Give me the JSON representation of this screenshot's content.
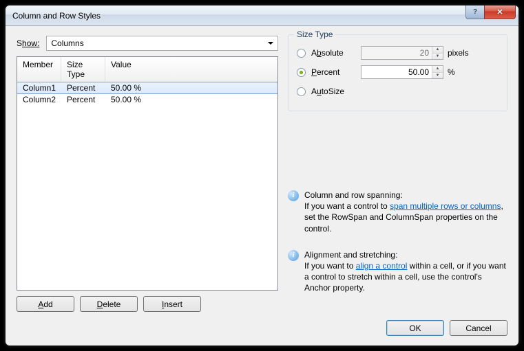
{
  "title": "Column and Row Styles",
  "show_label_pre": "S",
  "show_label_post": "how:",
  "show_value": "Columns",
  "headers": {
    "member": "Member",
    "size_type": "Size Type",
    "value": "Value"
  },
  "rows": [
    {
      "member": "Column1",
      "type": "Percent",
      "value": "50.00 %",
      "selected": true
    },
    {
      "member": "Column2",
      "type": "Percent",
      "value": "50.00 %",
      "selected": false
    }
  ],
  "buttons": {
    "add_u": "A",
    "add_rest": "dd",
    "del_u": "D",
    "del_rest": "elete",
    "ins_u": "I",
    "ins_rest": "nsert",
    "ok": "OK",
    "cancel": "Cancel"
  },
  "sizetype": {
    "legend": "Size Type",
    "absolute_u": "b",
    "absolute_pre": "A",
    "absolute_post": "solute",
    "percent_u": "P",
    "percent_post": "ercent",
    "autosize_u": "u",
    "autosize_pre": "A",
    "autosize_post": "toSize",
    "abs_value": "20",
    "abs_unit": "pixels",
    "pct_value": "50.00",
    "pct_unit": "%"
  },
  "info1": {
    "heading": "Column and row spanning:",
    "pre": "If you want a control to ",
    "link": "span multiple rows or columns",
    "post": ", set the RowSpan and ColumnSpan properties on the control."
  },
  "info2": {
    "heading": "Alignment and stretching:",
    "pre": "If you want to ",
    "link": "align a control",
    "post": " within a cell, or if you want a control to stretch within a cell, use the control's Anchor property."
  }
}
